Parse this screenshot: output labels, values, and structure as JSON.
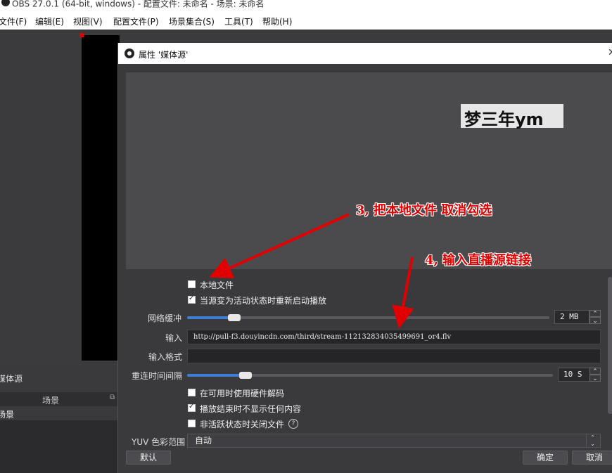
{
  "window": {
    "title": "OBS 27.0.1 (64-bit, windows) - 配置文件: 未命名 - 场景: 未命名"
  },
  "menu": [
    {
      "label": "文件(F)"
    },
    {
      "label": "编辑(E)"
    },
    {
      "label": "视图(V)"
    },
    {
      "label": "配置文件(P)"
    },
    {
      "label": "场景集合(S)"
    },
    {
      "label": "工具(T)"
    },
    {
      "label": "帮助(H)"
    }
  ],
  "left_dock": {
    "sources_label": "媒体源",
    "scenes_header": "场景",
    "scene_item": "场景"
  },
  "dialog": {
    "title": "属性 '媒体源'",
    "preview_watermark": "梦三年ym",
    "local_file_label": "本地文件",
    "local_file_checked": false,
    "restart_label": "当源变为活动状态时重新启动播放",
    "restart_checked": true,
    "network_buffer_label": "网络缓冲",
    "network_buffer_value": "2 MB",
    "network_buffer_level": 0.13,
    "input_label": "输入",
    "input_value": "http://pull-f3.douyincdn.com/third/stream-112132834035499691_or4.flv",
    "input_format_label": "输入格式",
    "input_format_value": "",
    "reconnect_label": "重连时间间隔",
    "reconnect_value": "10 S",
    "reconnect_level": 0.16,
    "hw_decode_label": "在可用时使用硬件解码",
    "hw_decode_checked": false,
    "hide_on_end_label": "播放结束时不显示任何内容",
    "hide_on_end_checked": true,
    "close_inactive_label": "非活跃状态时关闭文件",
    "close_inactive_checked": false,
    "yuv_label": "YUV 色彩范围",
    "yuv_value": "自动",
    "defaults_button": "默认",
    "ok_button": "确定",
    "cancel_button": "取消"
  },
  "annotations": {
    "step3": "3, 把本地文件  取消勾选",
    "step4": "4, 输入直播源链接",
    "color": "#e00000"
  }
}
